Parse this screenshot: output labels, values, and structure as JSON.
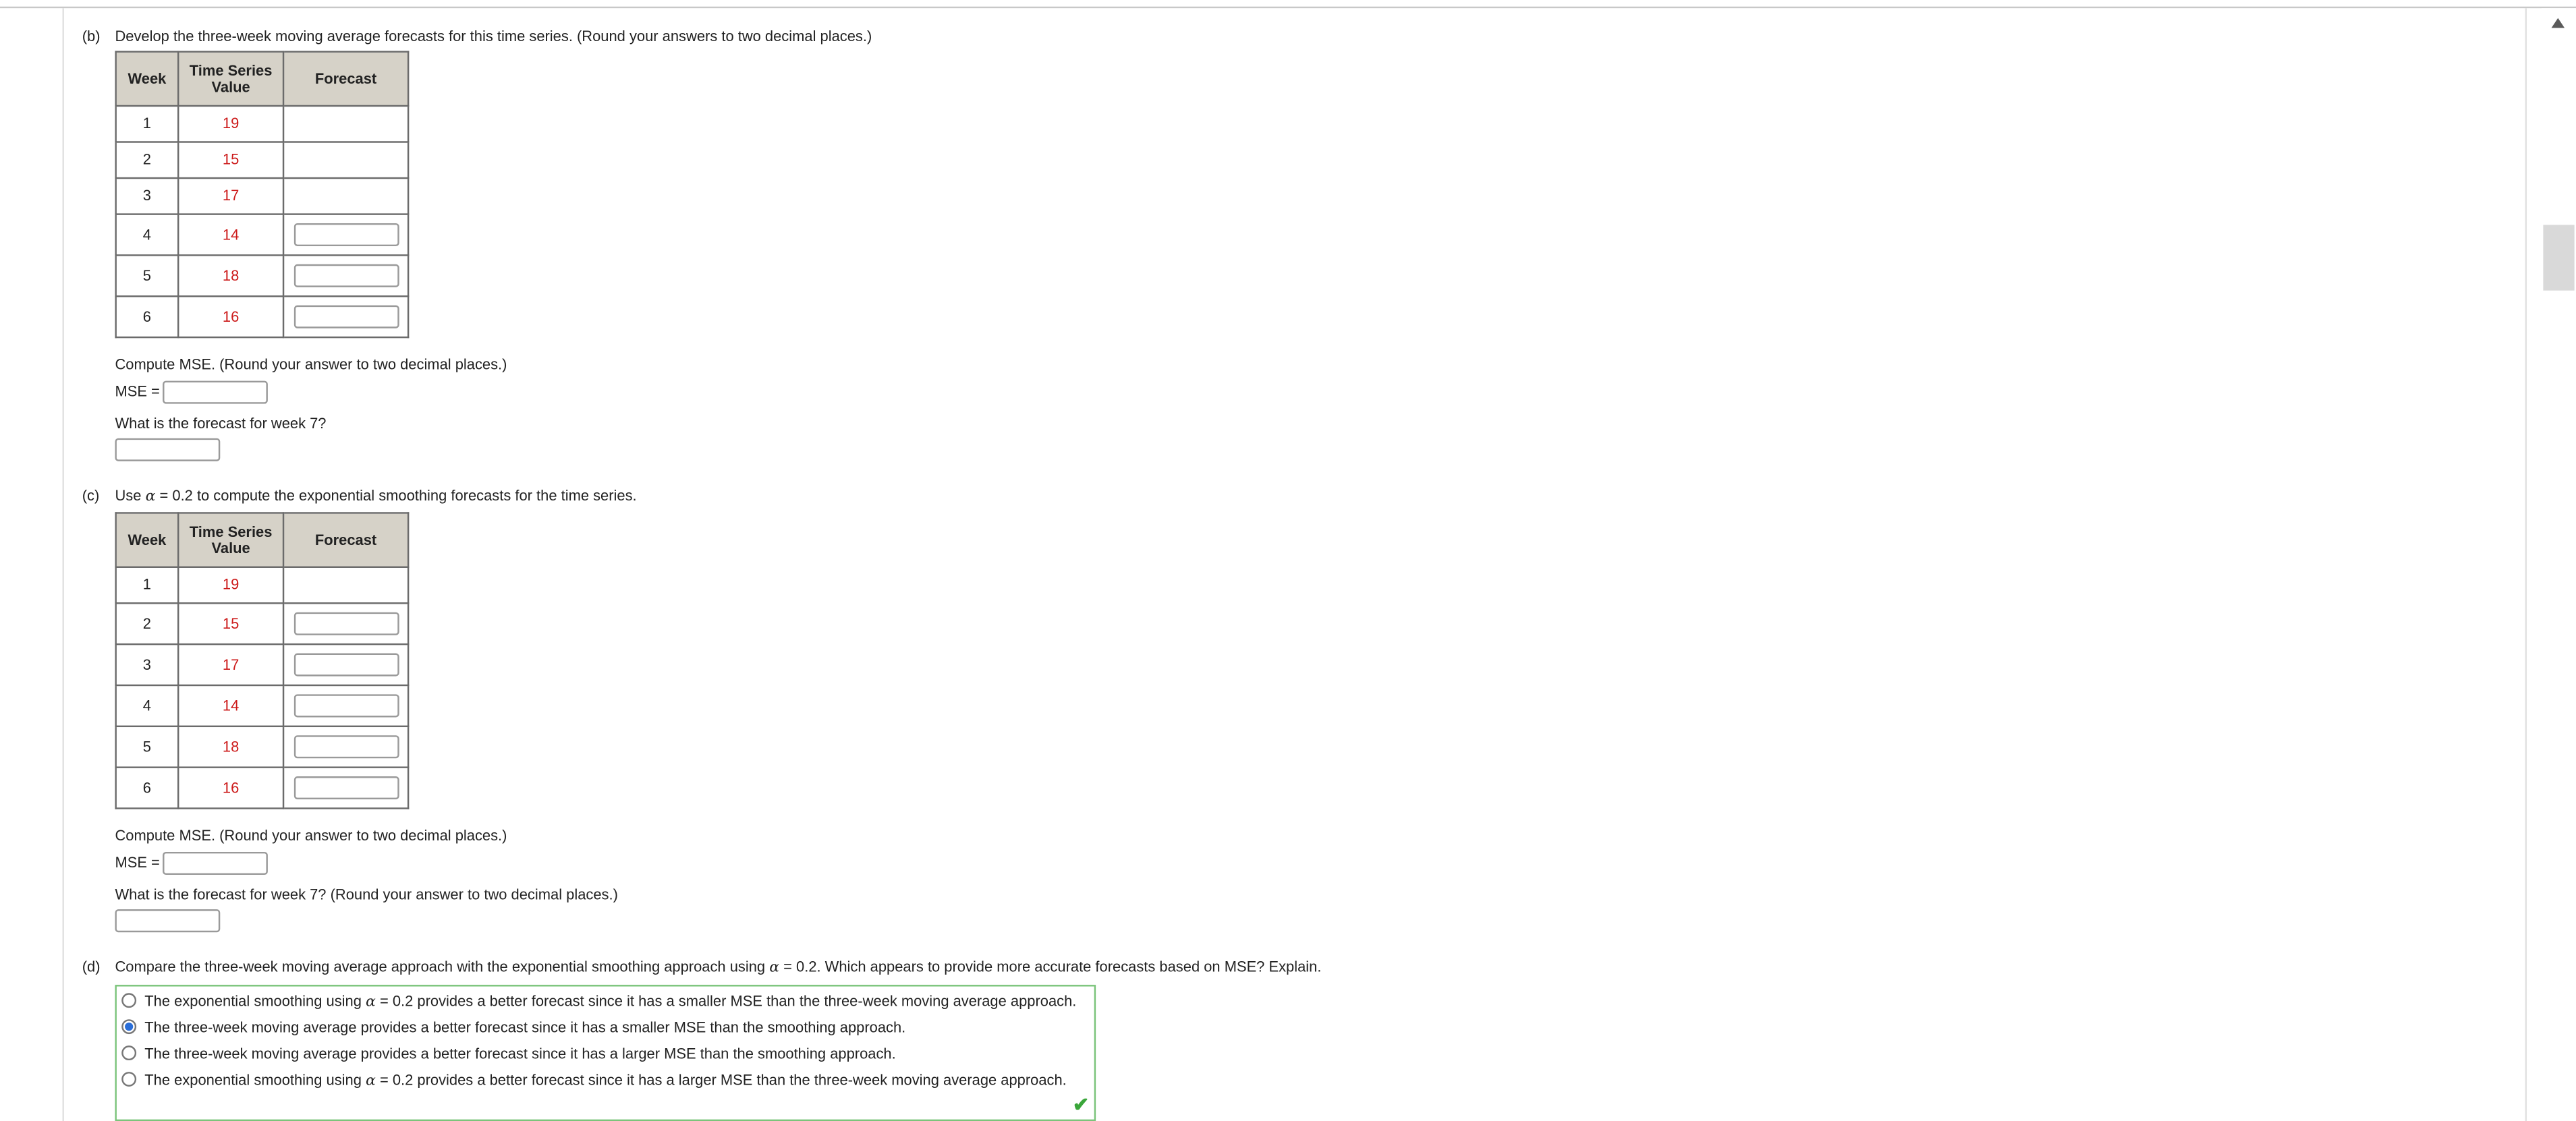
{
  "part_b": {
    "letter": "(b)",
    "prompt": "Develop the three-week moving average forecasts for this time series. (Round your answers to two decimal places.)",
    "table": {
      "headers": [
        "Week",
        "Time Series\nValue",
        "Forecast"
      ],
      "rows": [
        {
          "week": "1",
          "value": "19"
        },
        {
          "week": "2",
          "value": "15"
        },
        {
          "week": "3",
          "value": "17"
        },
        {
          "week": "4",
          "value": "14"
        },
        {
          "week": "5",
          "value": "18"
        },
        {
          "week": "6",
          "value": "16"
        }
      ]
    },
    "mse_prompt": "Compute MSE. (Round your answer to two decimal places.)",
    "mse_label": "MSE =",
    "week7_prompt": "What is the forecast for week 7?"
  },
  "part_c": {
    "letter": "(c)",
    "prompt_prefix": "Use",
    "alpha_symbol": "α",
    "prompt_suffix": "= 0.2 to compute the exponential smoothing forecasts for the time series.",
    "table": {
      "headers": [
        "Week",
        "Time Series\nValue",
        "Forecast"
      ],
      "rows": [
        {
          "week": "1",
          "value": "19"
        },
        {
          "week": "2",
          "value": "15"
        },
        {
          "week": "3",
          "value": "17"
        },
        {
          "week": "4",
          "value": "14"
        },
        {
          "week": "5",
          "value": "18"
        },
        {
          "week": "6",
          "value": "16"
        }
      ]
    },
    "mse_prompt": "Compute MSE. (Round your answer to two decimal places.)",
    "mse_label": "MSE =",
    "week7_prompt": "What is the forecast for week 7? (Round your answer to two decimal places.)"
  },
  "part_d": {
    "letter": "(d)",
    "prompt_prefix": "Compare the three-week moving average approach with the exponential smoothing approach using",
    "alpha_symbol": "α",
    "prompt_suffix": "= 0.2. Which appears to provide more accurate forecasts based on MSE? Explain.",
    "choices": [
      {
        "pre": "The exponential smoothing using",
        "alpha": "α",
        "post": "= 0.2 provides a better forecast since it has a smaller MSE than the three-week moving average approach.",
        "selected": false
      },
      {
        "pre": "The three-week moving average provides a better forecast since it has a smaller MSE than the smoothing approach.",
        "alpha": "",
        "post": "",
        "selected": true
      },
      {
        "pre": "The three-week moving average provides a better forecast since it has a larger MSE than the smoothing approach.",
        "alpha": "",
        "post": "",
        "selected": false
      },
      {
        "pre": "The exponential smoothing using",
        "alpha": "α",
        "post": "= 0.2 provides a better forecast since it has a larger MSE than the three-week moving average approach.",
        "selected": false
      }
    ],
    "status_icon": "checkmark-icon",
    "colors": {
      "correct_border": "#7bc47b",
      "check": "#3aa63a"
    }
  },
  "colors": {
    "value_text": "#cc1a1a",
    "header_bg": "#d6d2c8",
    "radio_selected": "#2a6ed8"
  }
}
